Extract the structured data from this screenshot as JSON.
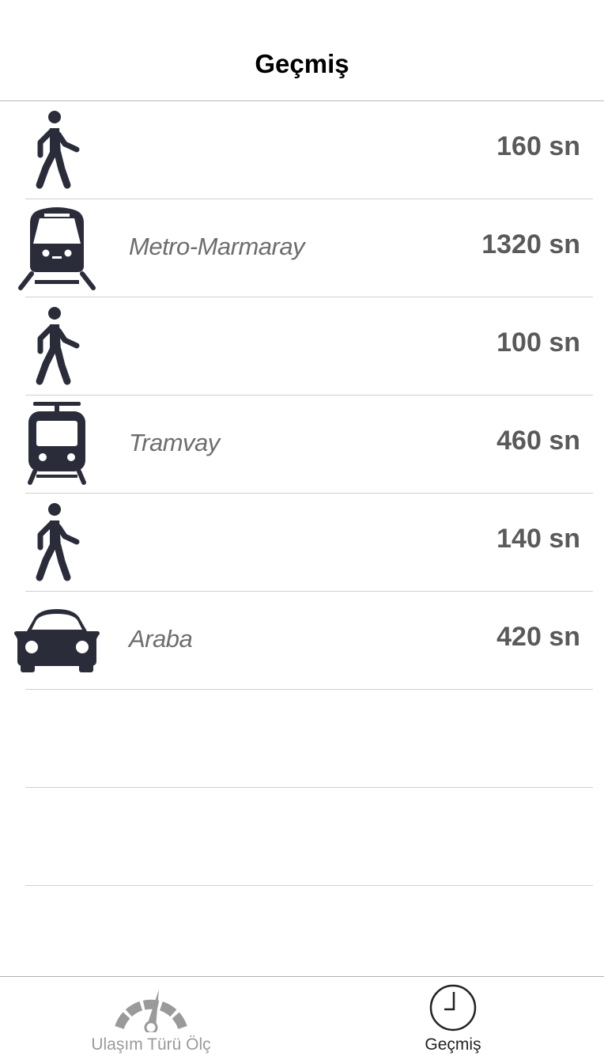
{
  "nav": {
    "title": "Geçmiş"
  },
  "history": [
    {
      "mode_icon": "walking-person-icon",
      "label": "",
      "duration": "160 sn"
    },
    {
      "mode_icon": "metro-train-icon",
      "label": "Metro-Marmaray",
      "duration": "1320 sn"
    },
    {
      "mode_icon": "walking-person-icon",
      "label": "",
      "duration": "100 sn"
    },
    {
      "mode_icon": "tram-icon",
      "label": "Tramvay",
      "duration": "460 sn"
    },
    {
      "mode_icon": "walking-person-icon",
      "label": "",
      "duration": "140 sn"
    },
    {
      "mode_icon": "car-icon",
      "label": "Araba",
      "duration": "420 sn"
    }
  ],
  "tabbar": {
    "measure": {
      "label": "Ulaşım Türü Ölç",
      "icon": "speedometer-icon"
    },
    "history": {
      "label": "Geçmiş",
      "icon": "clock-icon"
    }
  },
  "colors": {
    "icon": "#2a2c3a",
    "separator": "#d0d0d0",
    "inactive_tab": "#9a9a9a"
  }
}
